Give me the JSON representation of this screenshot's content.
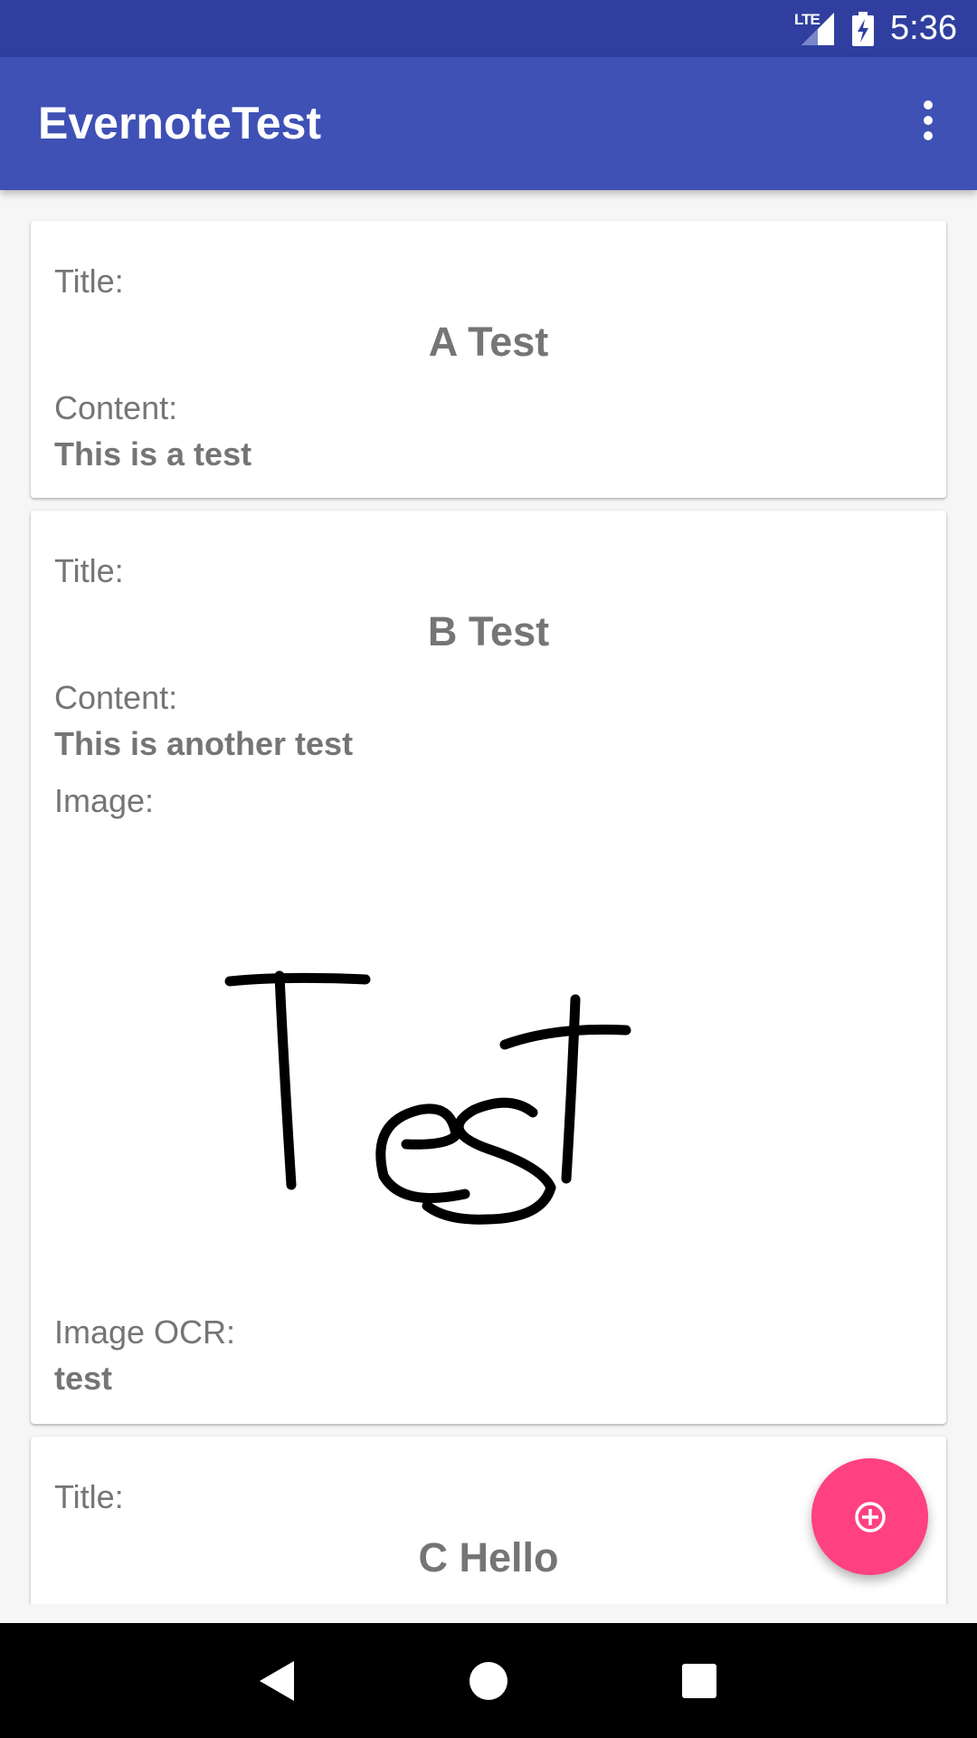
{
  "status_bar": {
    "network": "LTE",
    "time": "5:36"
  },
  "app_bar": {
    "title": "EvernoteTest",
    "overflow_icon": "more-vert-icon"
  },
  "notes": [
    {
      "title_label": "Title:",
      "title": "A Test",
      "content_label": "Content:",
      "content": "This is a test"
    },
    {
      "title_label": "Title:",
      "title": "B Test",
      "content_label": "Content:",
      "content": "This is another test",
      "image_label": "Image:",
      "image_ocr_label": "Image OCR:",
      "image_ocr": "test"
    },
    {
      "title_label": "Title:",
      "title": "C Hello"
    }
  ],
  "fab": {
    "icon": "add-circle-icon",
    "color": "#ff4081"
  },
  "nav_bar": {
    "back_icon": "back-icon",
    "home_icon": "home-icon",
    "recents_icon": "recents-icon"
  },
  "colors": {
    "primary": "#3f51b5",
    "primary_dark": "#303f9f",
    "accent": "#ff4081",
    "text_secondary": "#757575"
  }
}
